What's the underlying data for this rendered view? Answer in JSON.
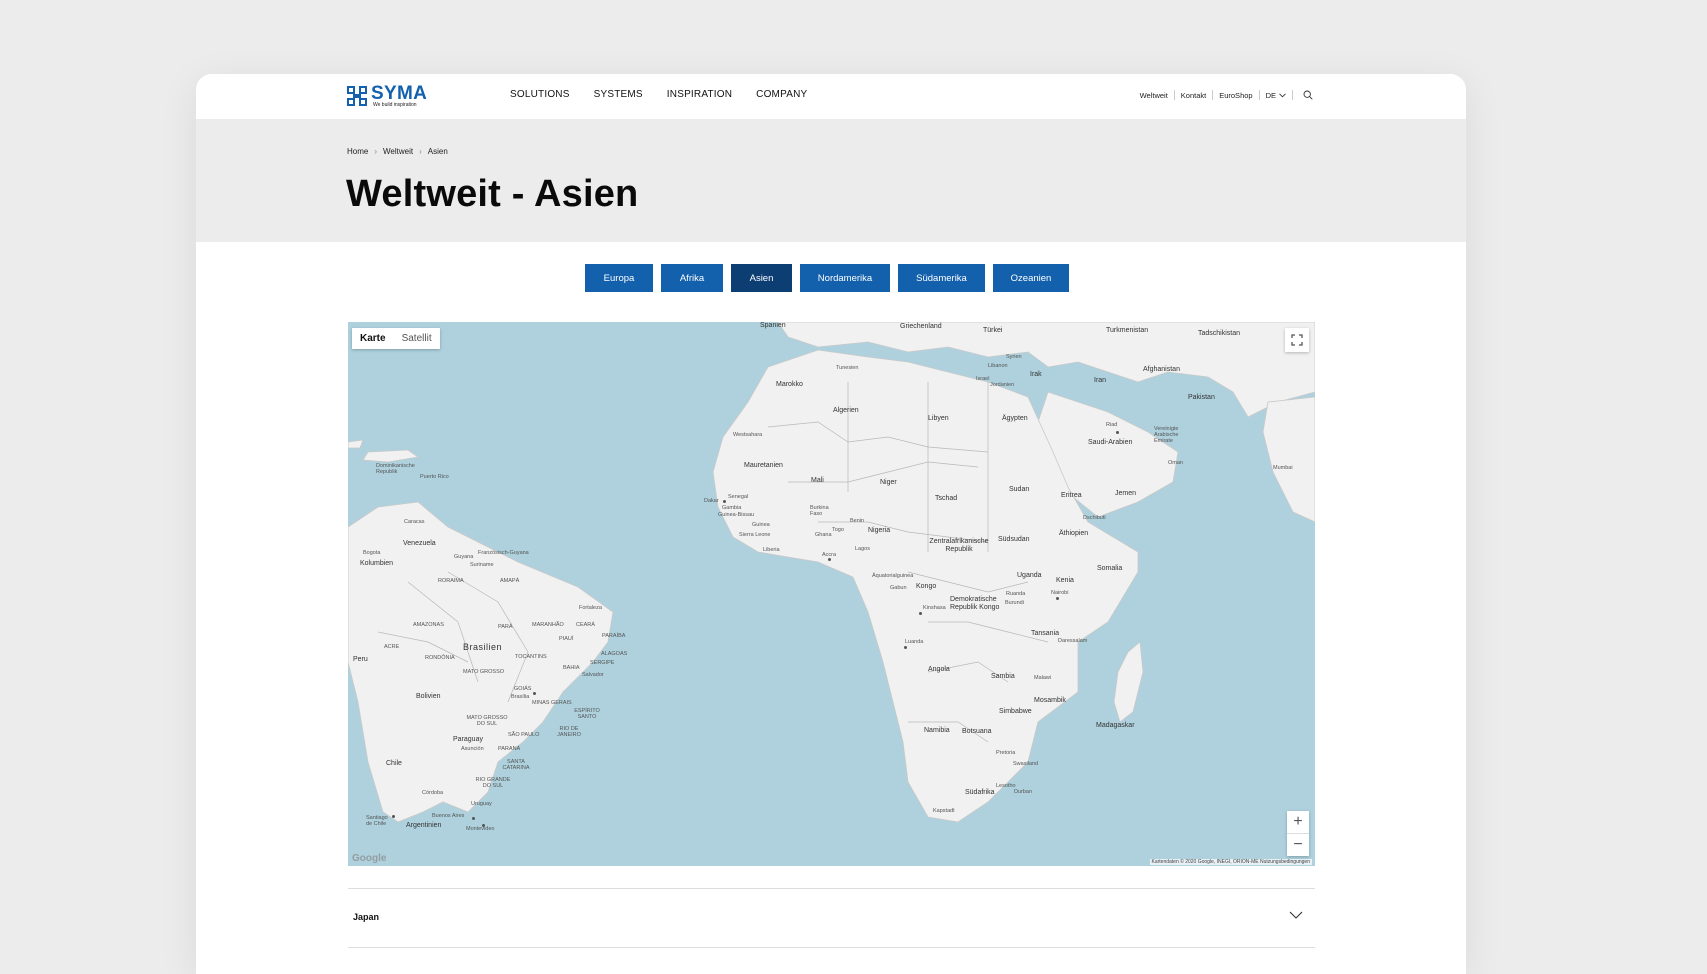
{
  "brand": {
    "name": "SYMA",
    "tagline": "We build inspiration",
    "color": "#1361ad"
  },
  "nav": {
    "items": [
      "SOLUTIONS",
      "SYSTEMS",
      "INSPIRATION",
      "COMPANY"
    ]
  },
  "utility": {
    "links": [
      "Weltweit",
      "Kontakt",
      "EuroShop"
    ],
    "language": "DE"
  },
  "breadcrumb": [
    "Home",
    "Weltweit",
    "Asien"
  ],
  "page_title": "Weltweit - Asien",
  "region_tabs": {
    "items": [
      {
        "label": "Europa",
        "active": false
      },
      {
        "label": "Afrika",
        "active": false
      },
      {
        "label": "Asien",
        "active": true
      },
      {
        "label": "Nordamerika",
        "active": false
      },
      {
        "label": "Südamerika",
        "active": false
      },
      {
        "label": "Ozeanien",
        "active": false
      }
    ],
    "color": "#1361ad",
    "active_color": "#0d3e73"
  },
  "map": {
    "type_toggle": {
      "map": "Karte",
      "satellite": "Satellit"
    },
    "attribution": "Kartendaten © 2020 Google, INEGI, ORION-ME   Nutzungsbedingungen",
    "google": "Google",
    "zoom_in": "+",
    "zoom_out": "−",
    "labels": {
      "spanien": "Spanien",
      "griechenland": "Griechenland",
      "tuerkei": "Türkei",
      "turkmenistan": "Turkmenistan",
      "tadschikistan": "Tadschikistan",
      "syrien": "Syrien",
      "libanon": "Libanon",
      "israel": "Israel",
      "jordanien": "Jordanien",
      "irak": "Irak",
      "iran": "Iran",
      "afghanistan": "Afghanistan",
      "pakistan": "Pakistan",
      "tunesien": "Tunesien",
      "marokko": "Marokko",
      "algerien": "Algerien",
      "libyen": "Libyen",
      "aegypten": "Ägypten",
      "saudi": "Saudi-Arabien",
      "riad": "Riad",
      "vae": "Vereinigte Arabische Emirate",
      "oman": "Oman",
      "westsahara": "Westsahara",
      "mauretanien": "Mauretanien",
      "mali": "Mali",
      "niger": "Niger",
      "tschad": "Tschad",
      "sudan": "Sudan",
      "eritrea": "Eritrea",
      "jemen": "Jemen",
      "dschibuti": "Dschibuti",
      "mumbai": "Mumbai",
      "senegal": "Senegal",
      "dakar": "Dakar",
      "gambia": "Gambia",
      "guinea_bissau": "Guinea-Bissau",
      "guinea": "Guinea",
      "sierra_leone": "Sierra Leone",
      "liberia": "Liberia",
      "burkina": "Burkina Faso",
      "ghana": "Ghana",
      "togo": "Togo",
      "benin": "Benin",
      "nigeria": "Nigeria",
      "accra": "Accra",
      "lagos": "Lagos",
      "zar": "Zentralafrikanische Republik",
      "suedsudan": "Südsudan",
      "aethiopien": "Äthiopien",
      "somalia": "Somalia",
      "aequatorial": "Äquatorialguinea",
      "gabun": "Gabun",
      "kongo": "Kongo",
      "drk": "Demokratische Republik Kongo",
      "uganda": "Uganda",
      "kenia": "Kenia",
      "nairobi": "Nairobi",
      "ruanda": "Ruanda",
      "burundi": "Burundi",
      "kinshasa": "Kinshasa",
      "tansania": "Tansania",
      "daressalam": "Daressalam",
      "luanda": "Luanda",
      "angola": "Angola",
      "sambia": "Sambia",
      "malawi": "Malawi",
      "mosambik": "Mosambik",
      "simbabwe": "Simbabwe",
      "madagaskar": "Madagaskar",
      "namibia": "Namibia",
      "botsuana": "Botsuana",
      "pretoria": "Pretoria",
      "swasiland": "Swasiland",
      "lesotho": "Lesotho",
      "durban": "Durban",
      "suedafrika": "Südafrika",
      "kapstadt": "Kapstadt",
      "dominikanische": "Dominikanische Republik",
      "puerto_rico": "Puerto Rico",
      "caracas": "Caracas",
      "venezuela": "Venezuela",
      "franz_guyana": "Französisch-Guyana",
      "guyana": "Guyana",
      "suriname": "Suriname",
      "bogota": "Bogota",
      "kolumbien": "Kolumbien",
      "roraima": "RORAIMA",
      "amapa": "AMAPÁ",
      "fortaleza": "Fortaleza",
      "amazonas": "AMAZONAS",
      "para": "PARÁ",
      "maranhao": "MARANHÃO",
      "ceara": "CEARÁ",
      "piaui": "PIAUÍ",
      "paraiba": "PARAÍBA",
      "alagoas": "ALAGOAS",
      "sergipe": "SERGIPE",
      "brasilien": "Brasilien",
      "acre": "ACRE",
      "rondonia": "RONDÔNIA",
      "tocantins": "TOCANTINS",
      "bahia": "BAHIA",
      "salvador": "Salvador",
      "peru": "Peru",
      "mato_grosso": "MATO GROSSO",
      "goias": "GOIÁS",
      "brasilia": "Brasília",
      "minas": "MINAS GERAIS",
      "bolivien": "Bolivien",
      "espirito": "ESPÍRITO SANTO",
      "mato_grosso_sul": "MATO GROSSO DO SUL",
      "sao_paulo": "SÃO PAULO",
      "rio": "RIO DE JANEIRO",
      "paraguay": "Paraguay",
      "asuncion": "Asunción",
      "parana": "PARANÁ",
      "santa_catarina": "SANTA CATARINA",
      "rio_grande": "RIO GRANDE DO SUL",
      "chile": "Chile",
      "cordoba": "Córdoba",
      "uruguay": "Uruguay",
      "buenos_aires": "Buenos Aires",
      "montevideo": "Montevideo",
      "santiago": "Santiago de Chile",
      "argentinien": "Argentinien"
    }
  },
  "accordion": {
    "items": [
      {
        "title": "Japan"
      }
    ]
  }
}
